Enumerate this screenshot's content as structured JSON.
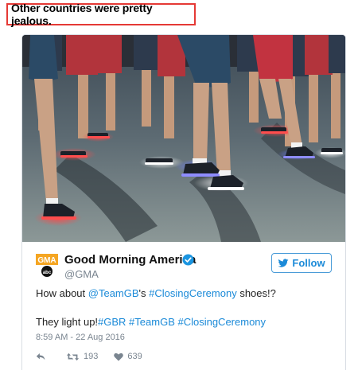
{
  "caption": "Other countries were pretty jealous.",
  "tweet": {
    "author_name": "Good Morning America",
    "handle": "@GMA",
    "logo_text": "GMA",
    "logo_sub": "abc",
    "follow_label": "Follow",
    "line1": {
      "prefix": "How about ",
      "mention": "@TeamGB",
      "middle": "'s ",
      "hashtag": "#ClosingCeremony",
      "suffix": " shoes!?"
    },
    "line2": {
      "prefix": "They light up!",
      "tags": "#GBR #TeamGB #ClosingCeremony"
    },
    "timestamp": "8:59 AM - 22 Aug 2016",
    "retweets": "193",
    "likes": "639"
  },
  "colors": {
    "accent_blue": "#1b8ad8",
    "caption_border": "#e53935",
    "muted_text": "#7a8590"
  },
  "icons": {
    "verified": "verified-badge-icon",
    "reply": "reply-icon",
    "retweet": "retweet-icon",
    "like": "heart-icon",
    "follow": "follow-bird-icon"
  }
}
